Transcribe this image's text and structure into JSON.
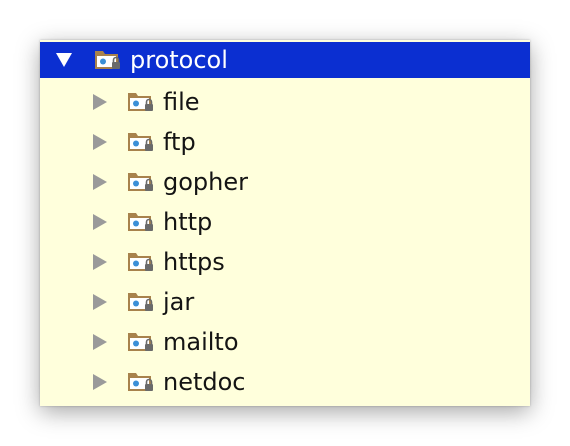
{
  "colors": {
    "panel_background": "#ffffdc",
    "selection": "#0b2fd1",
    "folder": "#a8824c",
    "folder_dot": "#3b8fd6",
    "lock": "#6a6a6a",
    "arrow_collapsed": "#9a9a9a"
  },
  "tree": {
    "root": {
      "label": "protocol",
      "expanded": true,
      "selected": true,
      "icon": "package-folder-icon"
    },
    "children": [
      {
        "label": "file",
        "expanded": false,
        "icon": "package-folder-icon"
      },
      {
        "label": "ftp",
        "expanded": false,
        "icon": "package-folder-icon"
      },
      {
        "label": "gopher",
        "expanded": false,
        "icon": "package-folder-icon"
      },
      {
        "label": "http",
        "expanded": false,
        "icon": "package-folder-icon"
      },
      {
        "label": "https",
        "expanded": false,
        "icon": "package-folder-icon"
      },
      {
        "label": "jar",
        "expanded": false,
        "icon": "package-folder-icon"
      },
      {
        "label": "mailto",
        "expanded": false,
        "icon": "package-folder-icon"
      },
      {
        "label": "netdoc",
        "expanded": false,
        "icon": "package-folder-icon"
      }
    ]
  }
}
